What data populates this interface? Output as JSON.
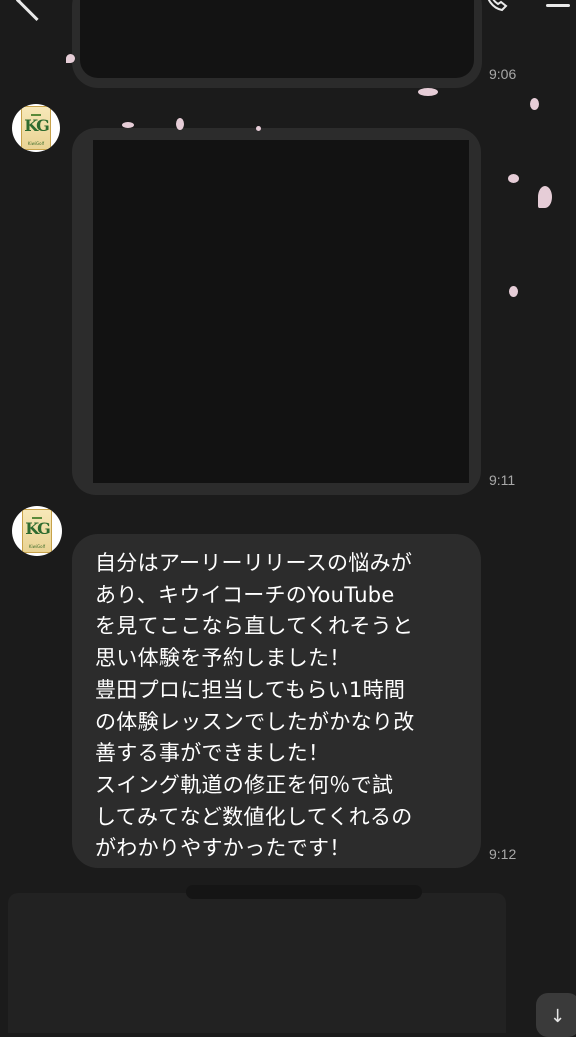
{
  "header": {
    "back_icon": "chevron-left-icon",
    "call_icon": "phone-icon",
    "menu_icon": "menu-icon"
  },
  "avatar": {
    "letters": "KG",
    "caption": "KiwiGolf"
  },
  "messages": [
    {
      "type": "media",
      "time": "9:06"
    },
    {
      "type": "media",
      "time": "9:11"
    },
    {
      "type": "text",
      "time": "9:12",
      "text": "自分はアーリーリリースの悩みが\nあり、キウイコーチのYouTube\nを見てここなら直してくれそうと\n思い体験を予約しました！\n豊田プロに担当してもらい1時間\nの体験レッスンでしたがかなり改\n善する事ができました！\nスイング軌道の修正を何％で試\nしてみてなど数値化してくれるの\nがわかりやすかったです！"
    }
  ],
  "scroll_button": {
    "icon": "arrow-down-icon",
    "glyph": "↓"
  },
  "colors": {
    "background": "#1b1b1b",
    "bubble": "#2c2c2c",
    "time_text": "#a8a8a8",
    "petal": "#f1d7e2"
  }
}
